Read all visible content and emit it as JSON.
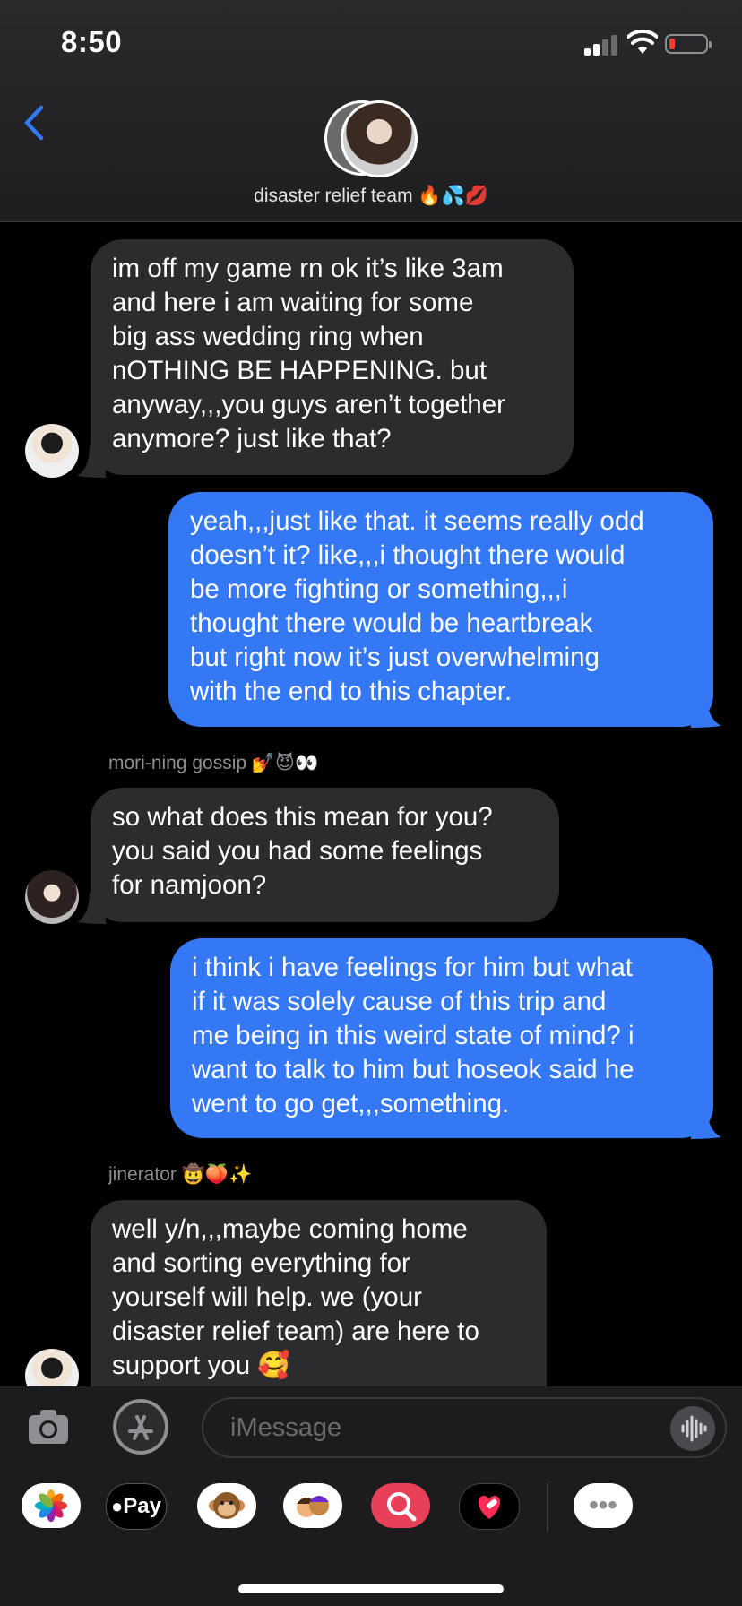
{
  "status_bar": {
    "time": "8:50"
  },
  "header": {
    "group_name": "disaster relief team 🔥💦💋"
  },
  "messages": [
    {
      "direction": "incoming",
      "text": "im off my game rn ok it’s like 3am\nand here i am waiting for some\nbig ass wedding ring when\nnOTHING BE HAPPENING. but\nanyway,,,you guys aren’t together\nanymore? just like that?"
    },
    {
      "direction": "outgoing",
      "text": "yeah,,,just like that. it seems really odd\ndoesn’t it? like,,,i thought there would\nbe more fighting or something,,,i\nthought there would be heartbreak\nbut right now it’s just overwhelming\nwith the end to this chapter."
    },
    {
      "direction": "incoming",
      "sender": "mori-ning gossip 💅😈👀",
      "text": "so what does this mean for you?\nyou said you had some feelings\nfor namjoon?"
    },
    {
      "direction": "outgoing",
      "text": "i think i have feelings for him but what\nif it was solely cause of this trip and\nme being in this weird state of mind? i\nwant to talk to him but hoseok said he\nwent to go get,,,something."
    },
    {
      "direction": "incoming",
      "sender": "jinerator 🤠🍑✨",
      "text": "well y/n,,,maybe coming home\nand sorting everything for\nyourself will help. we (your\ndisaster relief team) are here to\nsupport you 🥰"
    }
  ],
  "input": {
    "placeholder": "iMessage"
  },
  "app_drawer": {
    "apple_pay_label": "Pay",
    "more_label": "•••"
  },
  "colors": {
    "outgoing_bubble": "#3478f6",
    "incoming_bubble": "#2c2c2e",
    "accent": "#3478f6"
  },
  "icons": [
    "back-chevron-icon",
    "camera-icon",
    "app-store-icon",
    "audio-waveform-icon",
    "photos-app-icon",
    "apple-pay-icon",
    "animoji-monkey-icon",
    "memoji-icon",
    "image-search-icon",
    "digital-touch-icon",
    "more-apps-icon"
  ]
}
